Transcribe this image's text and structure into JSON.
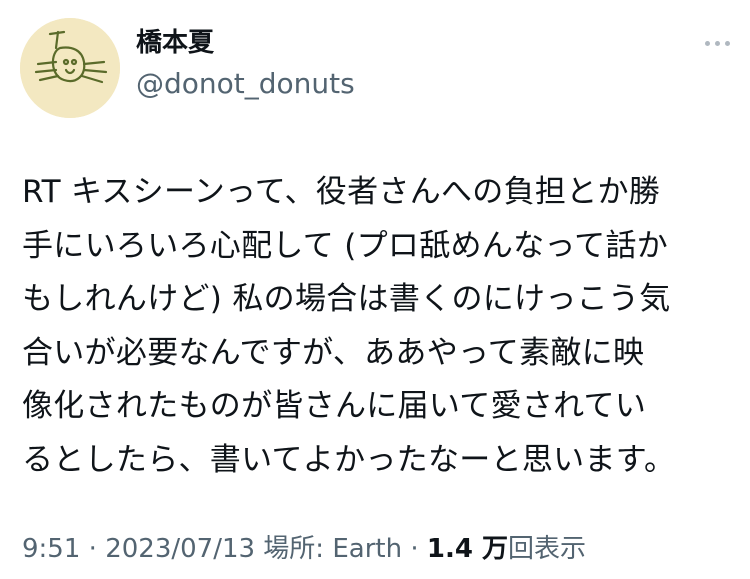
{
  "author": {
    "display_name": "橋本夏",
    "handle": "@donot_donuts",
    "avatar_icon": "cat-drawing-avatar"
  },
  "more_icon": "more-options-icon",
  "tweet": {
    "text": "RT キスシーンって、役者さんへの負担とか勝\n手にいろいろ心配して (プロ舐めんなって話か\nもしれんけど) 私の場合は書くのにけっこう気\n合いが必要なんですが、ああやって素敵に映\n像化されたものが皆さんに届いて愛されてい\nるとしたら、書いてよかったなーと思います。"
  },
  "meta": {
    "time": "9:51",
    "sep1": " · ",
    "date": "2023/07/13",
    "location_label": " 場所: Earth",
    "sep2": " · ",
    "views_count": "1.4 万",
    "views_label": "回表示"
  },
  "colors": {
    "text_primary": "#0f1419",
    "text_secondary": "#536471",
    "avatar_bg": "#f3e8c1"
  }
}
